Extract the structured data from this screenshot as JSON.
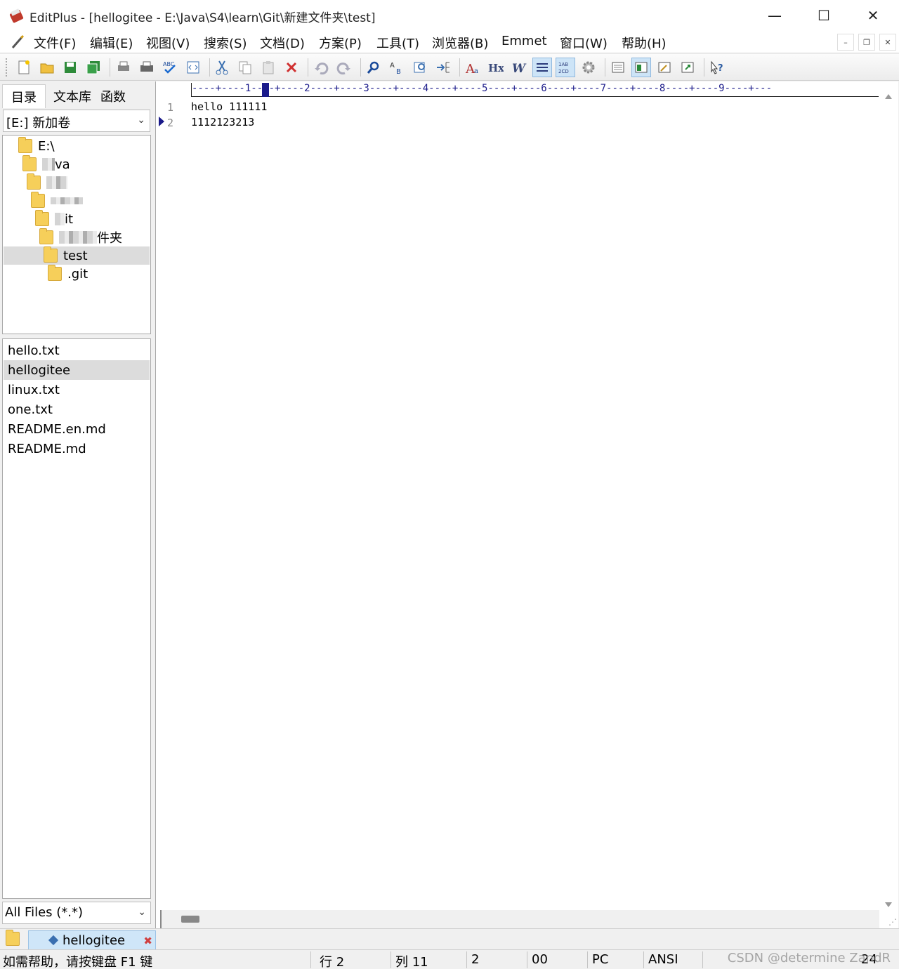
{
  "window": {
    "title": "EditPlus - [hellogitee - E:\\Java\\S4\\learn\\Git\\新建文件夹\\test]",
    "minimize": "—",
    "maximize": "☐",
    "close": "✕"
  },
  "menu": {
    "items": [
      "文件(F)",
      "编辑(E)",
      "视图(V)",
      "搜索(S)",
      "文档(D)",
      "方案(P)",
      "工具(T)",
      "浏览器(B)",
      "Emmet",
      "窗口(W)",
      "帮助(H)"
    ],
    "mdi_min": "–",
    "mdi_restore": "❐",
    "mdi_close": "✕"
  },
  "toolbar": {
    "buttons": [
      "new-file",
      "open-file",
      "save",
      "save-all",
      "print-preview",
      "print",
      "spell-check",
      "html-preview",
      "cut",
      "copy",
      "paste",
      "delete",
      "undo",
      "redo",
      "find",
      "replace",
      "find-in-files",
      "goto-line",
      "font",
      "hx",
      "word-wrap",
      "line-number",
      "column-select",
      "settings",
      "view-1",
      "view-2",
      "view-3",
      "view-4",
      "help"
    ],
    "active": [
      "line-number",
      "column-select",
      "view-2"
    ]
  },
  "sidebar": {
    "tabs": [
      "目录",
      "文本库",
      "函数"
    ],
    "active_tab": "目录",
    "drive": "[E:] 新加卷",
    "tree": [
      {
        "label": "E:\\",
        "depth": 0
      },
      {
        "label": "va",
        "depth": 1,
        "obscured": true
      },
      {
        "label": "",
        "depth": 2,
        "obscured": true
      },
      {
        "label": "",
        "depth": 3,
        "obscured": true
      },
      {
        "label": "it",
        "depth": 4,
        "obscured": true
      },
      {
        "label": "件夹",
        "depth": 5,
        "obscured": true
      },
      {
        "label": "test",
        "depth": 6,
        "selected": true
      },
      {
        "label": ".git",
        "depth": 7
      }
    ],
    "files": [
      "hello.txt",
      "hellogitee",
      "linux.txt",
      "one.txt",
      "README.en.md",
      "README.md"
    ],
    "selected_file": "hellogitee",
    "filter": "All Files (*.*)"
  },
  "editor": {
    "ruler": "----+----1----+----2----+----3----+----4----+----5----+----6----+----7----+----8----+----9----+---",
    "lines": [
      {
        "num": "1",
        "text": "hello 111111"
      },
      {
        "num": "2",
        "text": "1112123213"
      }
    ],
    "current_line": 2
  },
  "doc_tabs": [
    {
      "label": "hellogitee",
      "active": true
    }
  ],
  "status": {
    "help": "如需帮助，请按键盘 F1 键",
    "line": "行 2",
    "col": "列 11",
    "lines_count": "2",
    "code": "00",
    "eol": "PC",
    "encoding": "ANSI",
    "extra": "24"
  },
  "watermark": "CSDN @determine ZandR"
}
